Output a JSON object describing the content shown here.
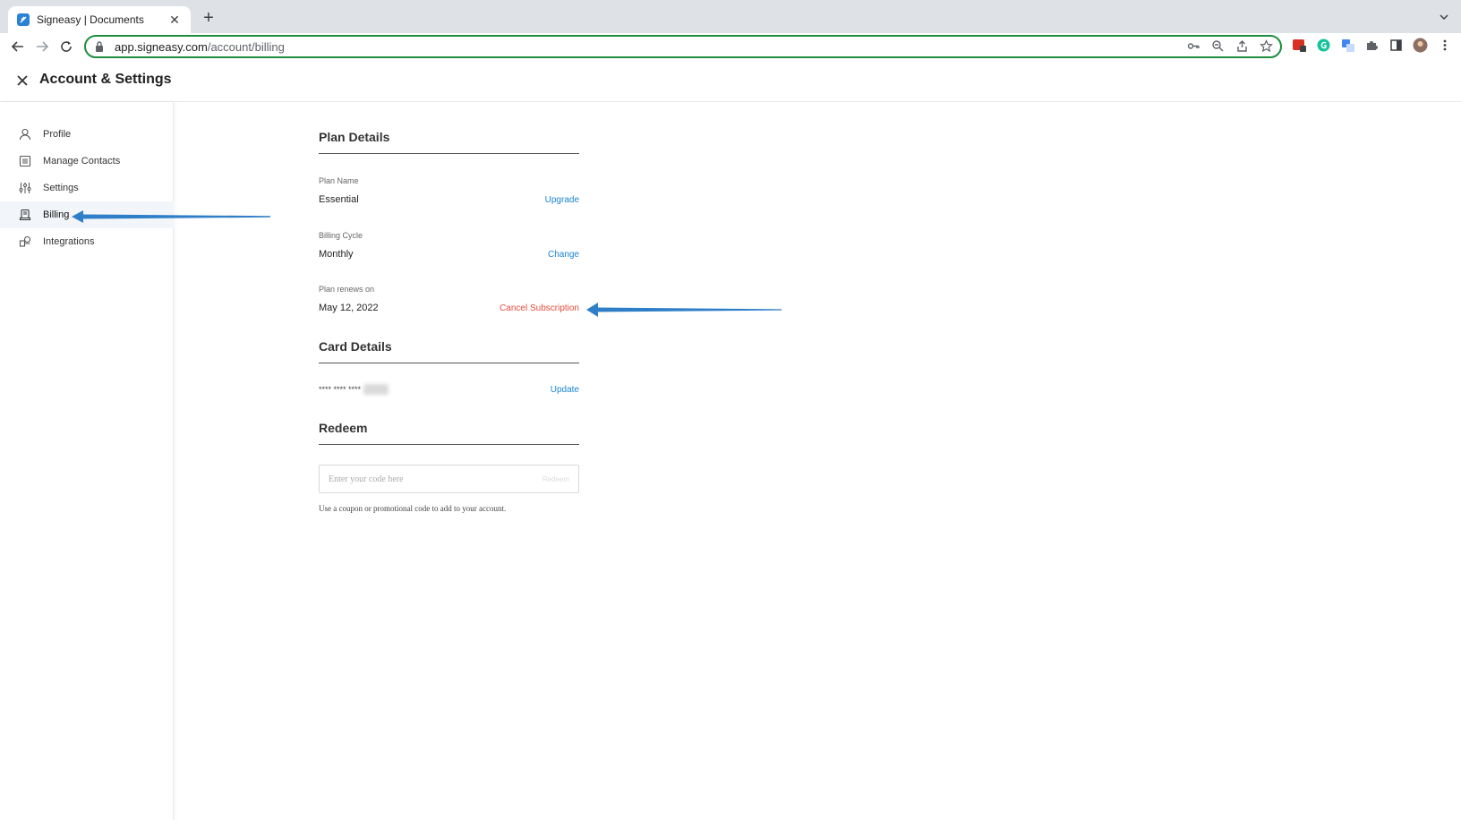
{
  "browser": {
    "tab_title": "Signeasy | Documents",
    "url_host": "app.signeasy.com",
    "url_path": "/account/billing"
  },
  "header": {
    "title": "Account & Settings"
  },
  "sidebar": {
    "items": [
      {
        "label": "Profile",
        "icon": "person-icon"
      },
      {
        "label": "Manage Contacts",
        "icon": "contacts-icon"
      },
      {
        "label": "Settings",
        "icon": "sliders-icon"
      },
      {
        "label": "Billing",
        "icon": "billing-icon",
        "active": true
      },
      {
        "label": "Integrations",
        "icon": "integrations-icon"
      }
    ]
  },
  "plan": {
    "section_title": "Plan Details",
    "plan_name_label": "Plan Name",
    "plan_name_value": "Essential",
    "plan_name_action": "Upgrade",
    "billing_cycle_label": "Billing Cycle",
    "billing_cycle_value": "Monthly",
    "billing_cycle_action": "Change",
    "renews_label": "Plan renews on",
    "renews_value": "May 12, 2022",
    "renews_action": "Cancel Subscription"
  },
  "card": {
    "section_title": "Card Details",
    "masked_number": "**** **** ****",
    "action": "Update"
  },
  "redeem": {
    "section_title": "Redeem",
    "placeholder": "Enter your code here",
    "button_label": "Redeem",
    "help_text": "Use a coupon or promotional code to add to your account."
  },
  "colors": {
    "link": "#1a85d6",
    "danger": "#e74c3c",
    "arrow": "#2f7fc8",
    "omnibox_border": "#1e8e3e"
  }
}
